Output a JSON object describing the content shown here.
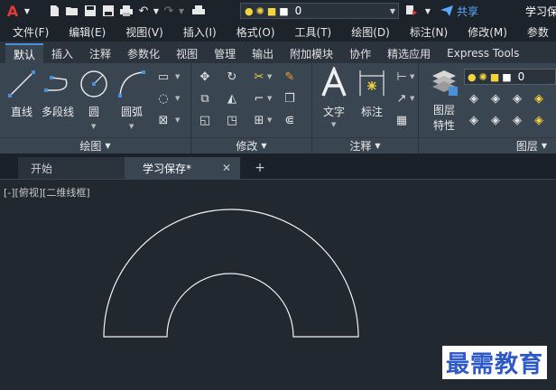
{
  "titlebar": {
    "layer_value": "0",
    "share_label": "共享",
    "doc_title": "学习保存"
  },
  "menu": {
    "items": [
      "文件(F)",
      "编辑(E)",
      "视图(V)",
      "插入(I)",
      "格式(O)",
      "工具(T)",
      "绘图(D)",
      "标注(N)",
      "修改(M)",
      "参数"
    ]
  },
  "ribbon_tabs": {
    "items": [
      "默认",
      "插入",
      "注释",
      "参数化",
      "视图",
      "管理",
      "输出",
      "附加模块",
      "协作",
      "精选应用",
      "Express Tools"
    ],
    "active_index": 0
  },
  "ribbon": {
    "draw": {
      "line": "直线",
      "polyline": "多段线",
      "circle": "圆",
      "arc": "圆弧",
      "footer": "绘图"
    },
    "modify": {
      "footer": "修改"
    },
    "annotation": {
      "text": "文字",
      "dimension": "标注",
      "footer": "注释"
    },
    "layers": {
      "properties_line1": "图层",
      "properties_line2": "特性",
      "layer_value": "0",
      "footer": "图层"
    }
  },
  "doc_tabs": {
    "start": "开始",
    "current": "学习保存*",
    "close_glyph": "✕",
    "add_glyph": "+"
  },
  "canvas": {
    "viewport_label": "[-][俯视][二维线框]",
    "watermark": "最需教育"
  },
  "colors": {
    "background": "#212830",
    "ribbon": "#3a4552",
    "accent_blue": "#4a90d9",
    "logo_red": "#e53935",
    "watermark_blue": "#2c58c8"
  }
}
